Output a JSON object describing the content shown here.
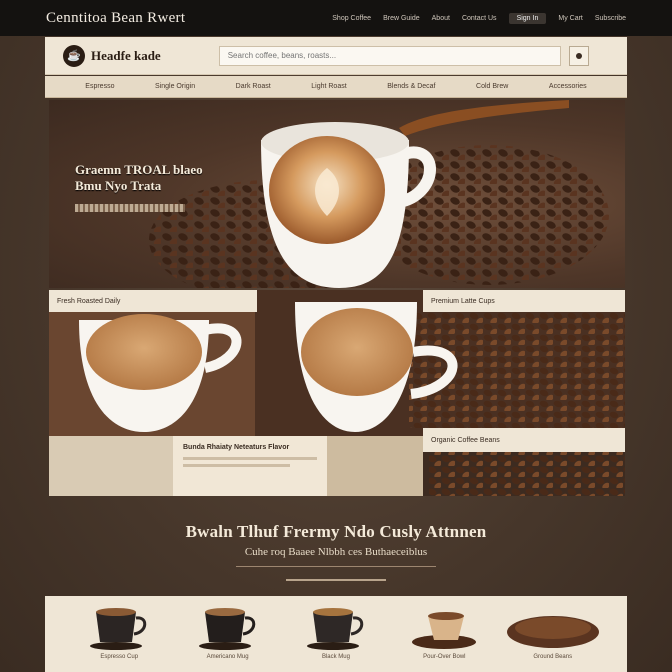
{
  "topbar": {
    "brand": "Cenntitoa Bean Rwert",
    "links": [
      "Shop Coffee",
      "Brew Guide",
      "About",
      "Contact Us",
      "Sign In",
      "My Cart",
      "Subscribe"
    ]
  },
  "header": {
    "logo_text": "Headfe kade",
    "search_placeholder": "Search coffee, beans, roasts..."
  },
  "nav": {
    "items": [
      "Espresso",
      "Single Origin",
      "Dark Roast",
      "Light Roast",
      "Blends & Decaf",
      "Cold Brew",
      "Accessories"
    ]
  },
  "hero": {
    "title_line1": "Graemn TROAL blaeo",
    "title_line2": "Bmu Nyo Trata"
  },
  "panels": {
    "tag_a": "Fresh Roasted Daily",
    "tag_b": "Premium Latte Cups",
    "tag_c": "Organic Coffee Beans",
    "desc_title": "Bunda Rhaiaty Neteaturs Flavor",
    "desc_line": ""
  },
  "headline": {
    "main": "Bwaln Tlhuf Frermy Ndo Cusly Attnnen",
    "sub": "Cuhe roq Baaee Nlbbh ces Buthaeceiblus"
  },
  "products": [
    {
      "label": "Espresso Cup"
    },
    {
      "label": "Americano Mug"
    },
    {
      "label": "Black Mug"
    },
    {
      "label": "Pour-Over Bowl"
    },
    {
      "label": "Ground Beans"
    }
  ],
  "colors": {
    "background": "#4a3a2e",
    "cream": "#efe6d6",
    "topbar": "#141210",
    "coffee": "#6e4e3a"
  }
}
